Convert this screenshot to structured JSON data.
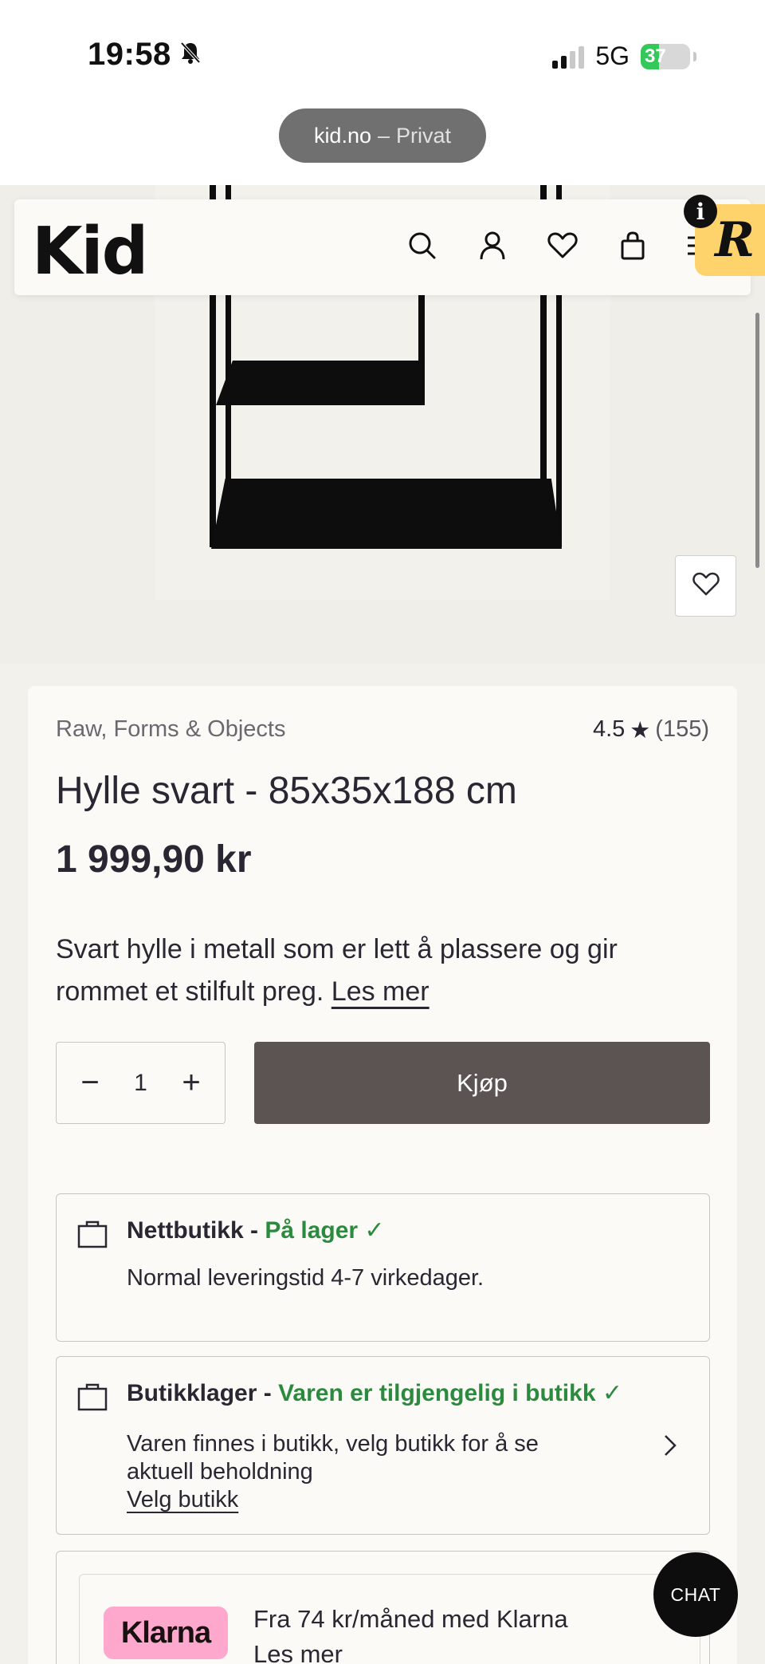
{
  "status_bar": {
    "time": "19:58",
    "network": "5G",
    "battery": "37",
    "battery_level": 0.37
  },
  "browser": {
    "domain": "kid.no",
    "mode_separator": "–",
    "mode": "Privat"
  },
  "header": {
    "logo": "Kid",
    "icons": [
      "search-icon",
      "account-icon",
      "heart-icon",
      "bag-icon",
      "menu-icon"
    ],
    "badge_letter": "R",
    "info_letter": "i"
  },
  "product": {
    "brand": "Raw, Forms & Objects",
    "rating": "4.5",
    "rating_star": "★",
    "review_count": "(155)",
    "title": "Hylle svart - 85x35x188 cm",
    "price": "1 999,90 kr",
    "description": "Svart hylle i metall som er lett å plassere og gir rommet et stilfult preg.",
    "read_more": "Les mer",
    "quantity": "1",
    "minus": "−",
    "plus": "+",
    "buy_label": "Kjøp"
  },
  "availability": {
    "online": {
      "label": "Nettbutikk - ",
      "status": "På lager ✓",
      "detail": "Normal leveringstid 4-7 virkedager."
    },
    "store": {
      "label": "Butikklager - ",
      "status": "Varen er tilgjengelig i butikk ✓",
      "detail": "Varen finnes i butikk, velg butikk for å se aktuell beholdning",
      "link": "Velg butikk"
    }
  },
  "klarna": {
    "logo": "Klarna",
    "text": "Fra 74 kr/måned med Klarna",
    "link": "Les mer"
  },
  "chat": {
    "label": "CHAT"
  },
  "colors": {
    "accent_buy": "#5b5452",
    "in_stock_green": "#2b8a3e",
    "klarna_pink": "#ffa8cd",
    "badge_yellow": "#ffd36b"
  }
}
